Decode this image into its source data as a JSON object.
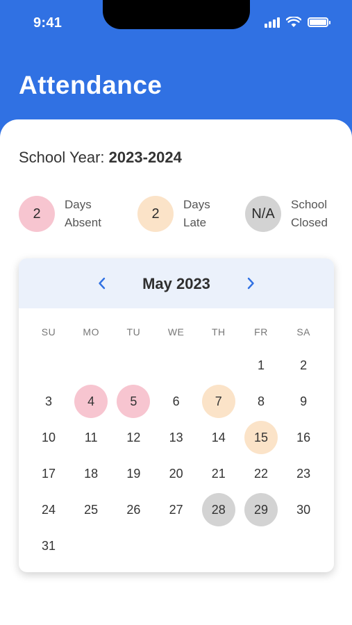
{
  "status_bar": {
    "time": "9:41"
  },
  "header": {
    "title": "Attendance"
  },
  "school_year": {
    "label": "School Year: ",
    "value": "2023-2024"
  },
  "stats": [
    {
      "value": "2",
      "line1": "Days",
      "line2": "Absent",
      "color": "#F7C5D0"
    },
    {
      "value": "2",
      "line1": "Days",
      "line2": "Late",
      "color": "#FBE3C8"
    },
    {
      "value": "N/A",
      "line1": "School",
      "line2": "Closed",
      "color": "#D3D3D3"
    }
  ],
  "calendar": {
    "month_label": "May 2023",
    "weekdays": [
      "SU",
      "MO",
      "TU",
      "WE",
      "TH",
      "FR",
      "SA"
    ],
    "first_weekday_index": 5,
    "days_in_month": 31,
    "absent_days": [
      4,
      5
    ],
    "late_days": [
      7,
      15
    ],
    "closed_days": [
      28,
      29
    ]
  },
  "colors": {
    "primary": "#3071E3",
    "absent": "#F7C5D0",
    "late": "#FBE3C8",
    "closed": "#D3D3D3",
    "calendar_header": "#EBF1FB"
  }
}
